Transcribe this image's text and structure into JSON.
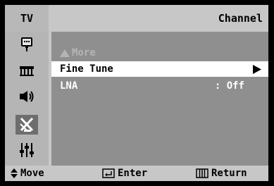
{
  "header": {
    "mode": "TV",
    "title": "Channel"
  },
  "sidebar": {
    "items": [
      {
        "icon": "picture-icon"
      },
      {
        "icon": "input-icon"
      },
      {
        "icon": "sound-icon"
      },
      {
        "icon": "channel-antenna-icon",
        "selected": true
      },
      {
        "icon": "setup-icon"
      }
    ]
  },
  "menu": {
    "more_label": "More",
    "items": [
      {
        "label": "Fine Tune",
        "selected": true
      },
      {
        "label": "LNA",
        "value": ": Off"
      }
    ]
  },
  "footer": {
    "move_label": "Move",
    "enter_label": "Enter",
    "return_label": "Return"
  },
  "colors": {
    "frame": "#c7c7c7",
    "panel": "#8f8f8f",
    "sidebar": "#b5b5b5",
    "selected_row": "#ffffff"
  }
}
